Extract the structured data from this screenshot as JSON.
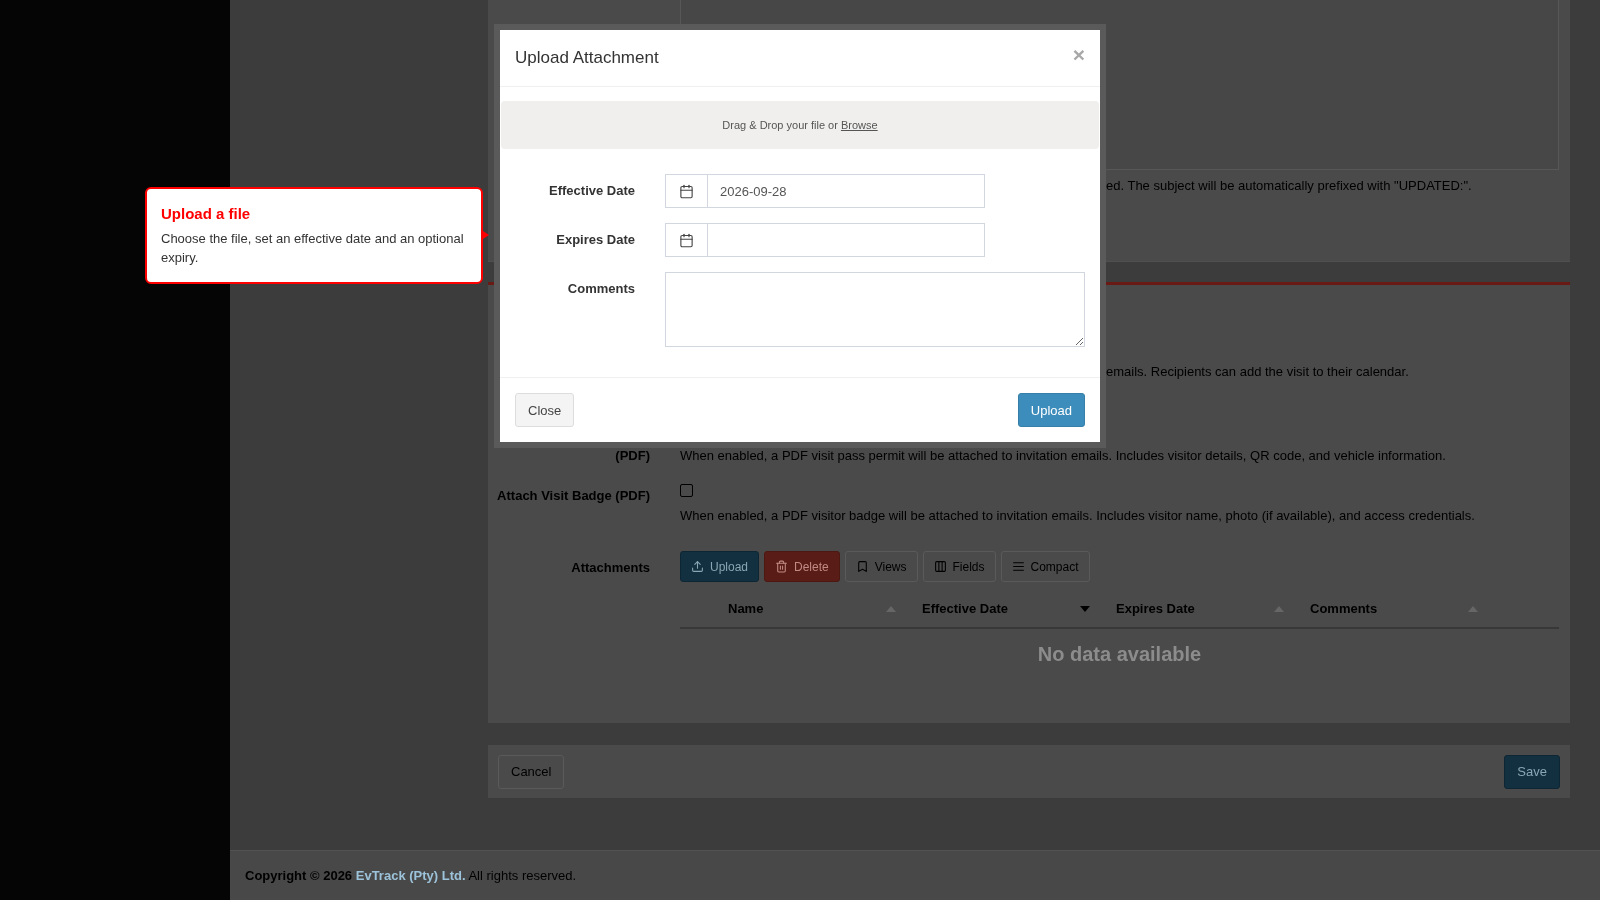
{
  "top_section": {
    "help_text": "ed. The subject will be automatically prefixed with \"UPDATED:\"."
  },
  "settings": {
    "rows": [
      {
        "kind": "note",
        "description": "emails. Recipients can add the visit to their calendar."
      },
      {
        "kind": "labeled",
        "label": "(PDF)",
        "description": "When enabled, a PDF visit pass permit will be attached to invitation emails. Includes visitor details, QR code, and vehicle information."
      },
      {
        "kind": "checkbox",
        "label": "Attach Visit Badge (PDF)",
        "checked": false,
        "description": "When enabled, a PDF visitor badge will be attached to invitation emails. Includes visitor name, photo (if available), and access credentials."
      }
    ],
    "attachments": {
      "label": "Attachments",
      "toolbar": [
        {
          "label": "Upload",
          "kind": "primary"
        },
        {
          "label": "Delete",
          "kind": "danger"
        },
        {
          "label": "Views",
          "kind": "default"
        },
        {
          "label": "Fields",
          "kind": "default"
        },
        {
          "label": "Compact",
          "kind": "default"
        }
      ],
      "columns": [
        {
          "label": "Name",
          "sorted": false
        },
        {
          "label": "Effective Date",
          "sorted": true
        },
        {
          "label": "Expires Date",
          "sorted": false
        },
        {
          "label": "Comments",
          "sorted": false
        }
      ],
      "empty_text": "No data available"
    }
  },
  "form_actions": [
    {
      "label": "Cancel",
      "kind": "default"
    },
    {
      "label": "Save",
      "kind": "primary"
    }
  ],
  "footer": {
    "copyright": "Copyright © 2026",
    "company": "EvTrack (Pty) Ltd.",
    "rights": "All rights reserved."
  },
  "dialog": {
    "title": "Upload Attachment",
    "close_symbol": "×",
    "dropzone": {
      "text": "Drag & Drop your file or",
      "link": "Browse"
    },
    "fields": [
      {
        "label": "Effective Date",
        "kind": "date",
        "value": "2026-09-28"
      },
      {
        "label": "Expires Date",
        "kind": "date"
      },
      {
        "label": "Comments",
        "kind": "textarea"
      }
    ],
    "buttons": [
      {
        "label": "Close",
        "kind": "default"
      },
      {
        "label": "Upload",
        "kind": "primary"
      }
    ]
  },
  "tooltip": {
    "title": "Upload a file",
    "text": "Choose the file, set an effective date and an optional expiry."
  }
}
